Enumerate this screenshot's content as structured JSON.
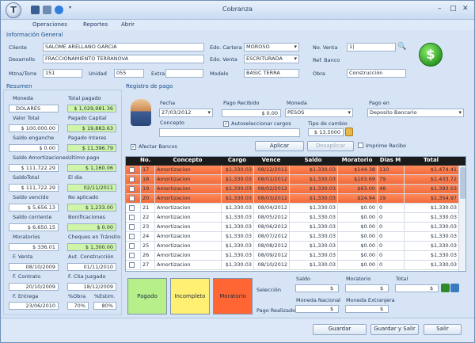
{
  "window": {
    "title": "Cobranza",
    "app_letter": "T"
  },
  "menu": [
    "Operaciones",
    "Reportes",
    "Abrir"
  ],
  "info": {
    "section": "Información General",
    "cliente_label": "Cliente",
    "cliente": "SALOME ARELLANO GARCIA",
    "desarrollo_label": "Desarrollo",
    "desarrollo": "FRACCIONAMIENTO TERRANOVA",
    "mza_label": "Mzna/Torre",
    "mza": "151",
    "unidad_label": "Unidad",
    "unidad": "055",
    "extra_label": "Extra",
    "extra": "",
    "modelo_label": "Modelo",
    "modelo": "BASIC TERRA",
    "edo_cartera_label": "Edo. Cartera",
    "edo_cartera": "MOROSO",
    "edo_venta_label": "Edo. Venta",
    "edo_venta": "ESCRITURADA",
    "no_venta_label": "No. Venta",
    "no_venta": "1|",
    "ref_banco_label": "Ref. Banco",
    "ref_banco": "",
    "obra_label": "Obra",
    "obra": "Construcción"
  },
  "resumen": {
    "section": "Resumen",
    "moneda_label": "Moneda",
    "moneda": "DOLARES",
    "total_pagado_label": "Total pagado",
    "total_pagado": "$ 1,029,981.36",
    "valor_total_label": "Valor Total",
    "valor_total": "$ 100,000.00",
    "pagado_capital_label": "Pagado Capital",
    "pagado_capital": "$ 19,883.63",
    "saldo_enganche_label": "Saldo enganche",
    "saldo_enganche": "$ 0.00",
    "pagado_interes_label": "Pagado Interes",
    "pagado_interes": "$ 11,396.79",
    "saldo_amort_label": "Saldo Amortizaciones",
    "saldo_amort": "$ 111,722.29",
    "ultimo_pago_label": "Ultimo pago",
    "ultimo_pago": "$ 1,160.06",
    "saldo_total_label": "SaldoTotal",
    "saldo_total": "$ 111,722.29",
    "el_dia_label": "El dia",
    "el_dia": "02/11/2011",
    "saldo_vencido_label": "Saldo vencido",
    "saldo_vencido": "$ 5,656.13",
    "no_aplicado_label": "No aplicado",
    "no_aplicado": "$ 1,233.00",
    "saldo_corriente_label": "Saldo corriente",
    "saldo_corriente": "$ 6,650.15",
    "bonificaciones_label": "Bonificaciones",
    "bonificaciones": "$ 0.00",
    "moratorios_label": "Moratorios",
    "moratorios": "$ 336.01",
    "cheques_label": "Cheques en Tránsito",
    "cheques": "$ 1,300.00",
    "f_venta_label": "F. Venta",
    "f_venta": "08/10/2009",
    "aut_const_label": "Aut. Construcción",
    "aut_const": "01/11/2010",
    "f_contrato_label": "F. Contrato",
    "f_contrato": "20/10/2009",
    "f_cita_label": "F. Cita Juzgado",
    "f_cita": "18/12/2009",
    "f_entrega_label": "F. Entrega",
    "f_entrega": "23/06/2010",
    "obra_pct_label": "%Obra",
    "obra_pct": "70%",
    "estim_pct_label": "%Estim.",
    "estim_pct": "80%"
  },
  "registro": {
    "section": "Registro de pago",
    "fecha_label": "Fecha",
    "fecha": "27/03/2012",
    "pago_recibido_label": "Pago Recibido",
    "pago_recibido": "$ 0.00",
    "moneda_label": "Moneda",
    "moneda": "PESOS",
    "pago_en_label": "Pago en",
    "pago_en": "Deposito Bancario",
    "concepto_label": "Concepto",
    "concepto": "",
    "autoselect_label": "Autoseleccionar cargos",
    "tipo_cambio_label": "Tipo de cambio",
    "tipo_cambio": "$ 13.5000",
    "afectar_bancos_label": "Afectar Bancos",
    "aplicar": "Aplicar",
    "desaplicar": "Desaplicar",
    "imprime_recibo": "Imprime Recibo"
  },
  "table": {
    "columns": [
      "No.",
      "Concepto",
      "Cargo",
      "Vence",
      "Saldo",
      "Moratorio",
      "Dias M",
      "Total"
    ],
    "rows": [
      {
        "no": "17",
        "concepto": "Amortizacion",
        "cargo": "$1,330.03",
        "vence": "08/12/2011",
        "saldo": "$1,330.03",
        "moratorio": "$144.38",
        "dias": "110",
        "total": "$1,474.41",
        "status": "moratorio"
      },
      {
        "no": "18",
        "concepto": "Amortizacion",
        "cargo": "$1,330.03",
        "vence": "08/01/2012",
        "saldo": "$1,330.03",
        "moratorio": "$103.69",
        "dias": "79",
        "total": "$1,433.72",
        "status": "moratorio"
      },
      {
        "no": "19",
        "concepto": "Amortizacion",
        "cargo": "$1,330.03",
        "vence": "08/02/2012",
        "saldo": "$1,330.03",
        "moratorio": "$63.00",
        "dias": "48",
        "total": "$1,393.03",
        "status": "moratorio"
      },
      {
        "no": "20",
        "concepto": "Amortizacion",
        "cargo": "$1,330.03",
        "vence": "08/03/2012",
        "saldo": "$1,330.03",
        "moratorio": "$24.94",
        "dias": "19",
        "total": "$1,354.97",
        "status": "moratorio"
      },
      {
        "no": "21",
        "concepto": "Amortizacion",
        "cargo": "$1,330.03",
        "vence": "08/04/2012",
        "saldo": "$1,330.03",
        "moratorio": "$0.00",
        "dias": "0",
        "total": "$1,330.03",
        "status": ""
      },
      {
        "no": "22",
        "concepto": "Amortizacion",
        "cargo": "$1,330.03",
        "vence": "08/05/2012",
        "saldo": "$1,330.03",
        "moratorio": "$0.00",
        "dias": "0",
        "total": "$1,330.03",
        "status": ""
      },
      {
        "no": "23",
        "concepto": "Amortizacion",
        "cargo": "$1,330.03",
        "vence": "08/06/2012",
        "saldo": "$1,330.03",
        "moratorio": "$0.00",
        "dias": "0",
        "total": "$1,330.03",
        "status": ""
      },
      {
        "no": "24",
        "concepto": "Amortizacion",
        "cargo": "$1,330.03",
        "vence": "08/07/2012",
        "saldo": "$1,330.03",
        "moratorio": "$0.00",
        "dias": "0",
        "total": "$1,330.03",
        "status": ""
      },
      {
        "no": "25",
        "concepto": "Amortizacion",
        "cargo": "$1,330.03",
        "vence": "08/08/2012",
        "saldo": "$1,330.03",
        "moratorio": "$0.00",
        "dias": "0",
        "total": "$1,330.03",
        "status": ""
      },
      {
        "no": "26",
        "concepto": "Amortizacion",
        "cargo": "$1,330.03",
        "vence": "08/09/2012",
        "saldo": "$1,330.03",
        "moratorio": "$0.00",
        "dias": "0",
        "total": "$1,330.03",
        "status": ""
      },
      {
        "no": "27",
        "concepto": "Amortizacion",
        "cargo": "$1,330.03",
        "vence": "08/10/2012",
        "saldo": "$1,330.03",
        "moratorio": "$0.00",
        "dias": "0",
        "total": "$1,330.03",
        "status": ""
      }
    ]
  },
  "legend": {
    "pagado": "Pagado",
    "incompleto": "Incompleto",
    "moratorio": "Moratorio"
  },
  "totals": {
    "saldo_label": "Saldo",
    "moratorio_label": "Moratorio",
    "total_label": "Total",
    "seleccion_label": "Selección",
    "seleccion_saldo": "$",
    "seleccion_moratorio": "$",
    "seleccion_total": "$",
    "moneda_nacional_label": "Moneda Nacional",
    "moneda_extranjera_label": "Moneda Extranjera",
    "pago_realizado_label": "Pago Realizado",
    "pago_mn": "$",
    "pago_me": "$"
  },
  "buttons": {
    "guardar": "Guardar",
    "guardar_salir": "Guardar y Salir",
    "salir": "Salir"
  },
  "colors": {
    "moratorio": "#f26a3a",
    "pagado": "#b7f08a",
    "incompleto": "#ffef73",
    "moratorio_legend": "#ff6633",
    "green_field": "#cff5a8"
  }
}
